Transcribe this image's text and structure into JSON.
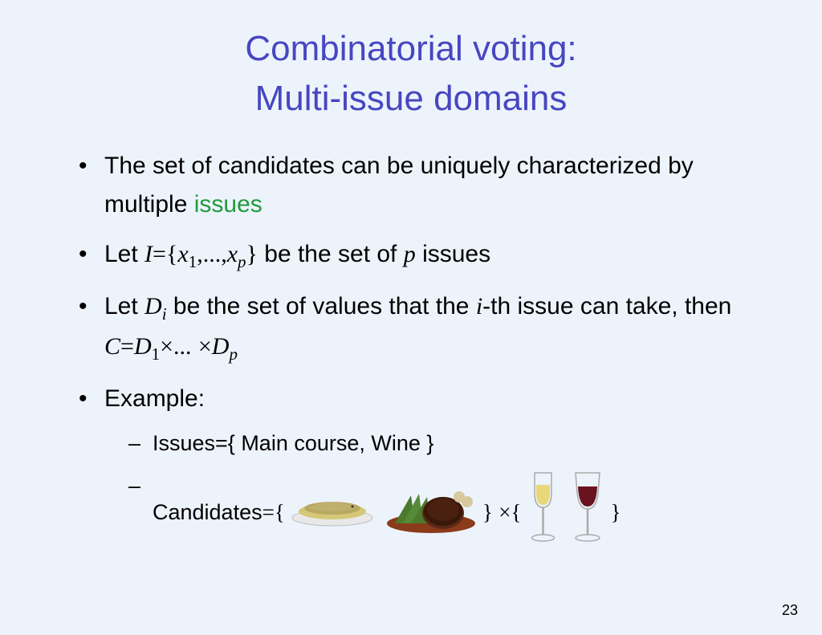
{
  "title_line1": "Combinatorial voting:",
  "title_line2": "Multi-issue domains",
  "bullets": {
    "b1_pre": "The set of candidates can be uniquely characterized by multiple ",
    "b1_issues": "issues",
    "b2_pre": "Let ",
    "b2_I": "I",
    "b2_eq": "=",
    "b2_brace": "{",
    "b2_x": "x",
    "b2_one": "1",
    "b2_dots": ",...,",
    "b2_xp": "x",
    "b2_p": "p",
    "b2_cbrace": "}",
    "b2_mid": " be the set of ",
    "b2_pvar": "p",
    "b2_post": " issues",
    "b3_pre": "Let ",
    "b3_D": "D",
    "b3_i": "i",
    "b3_mid1": " be the set of values that the ",
    "b3_ivar": "i",
    "b3_mid2": "-th issue can take, then ",
    "b3_C": "C",
    "b3_eq": "=",
    "b3_D1": "D",
    "b3_one": "1",
    "b3_times1": "×",
    "b3_dots": "...",
    "b3_times2": "×",
    "b3_Dp": "D",
    "b3_p": "p",
    "b4": "Example:",
    "s1": "Issues={ Main course, Wine }",
    "s2_pre": "Candidates",
    "s2_eq": "=",
    "s2_brace1": "{",
    "s2_close1": "}",
    "s2_times": "×",
    "s2_brace2": "{",
    "s2_close2": "}"
  },
  "images": {
    "fish": "fish-dish",
    "steak": "steak-dish",
    "white": "white-wine",
    "red": "red-wine"
  },
  "pagenum": "23"
}
